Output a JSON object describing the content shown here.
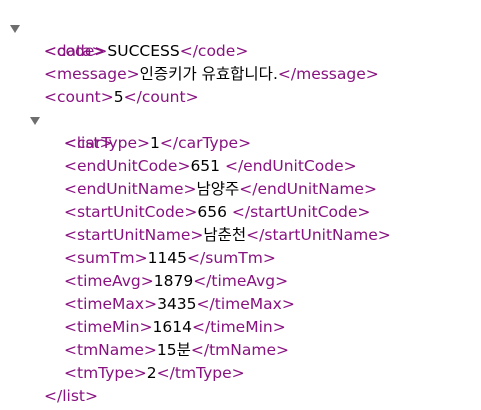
{
  "xml": {
    "root_tag": "data",
    "code": {
      "tag": "code",
      "value": "SUCCESS"
    },
    "message": {
      "tag": "message",
      "value": "인증키가 유효합니다."
    },
    "count": {
      "tag": "count",
      "value": "5"
    },
    "list": {
      "tag": "list",
      "items": [
        {
          "tag": "carType",
          "value": "1"
        },
        {
          "tag": "endUnitCode",
          "value": "651 "
        },
        {
          "tag": "endUnitName",
          "value": "남양주"
        },
        {
          "tag": "startUnitCode",
          "value": "656 "
        },
        {
          "tag": "startUnitName",
          "value": "남춘천"
        },
        {
          "tag": "sumTm",
          "value": "1145"
        },
        {
          "tag": "timeAvg",
          "value": "1879"
        },
        {
          "tag": "timeMax",
          "value": "3435"
        },
        {
          "tag": "timeMin",
          "value": "1614"
        },
        {
          "tag": "tmName",
          "value": "15분"
        },
        {
          "tag": "tmType",
          "value": "2"
        }
      ]
    }
  },
  "colors": {
    "tag": "#881280",
    "text": "#000000",
    "toggle": "#6e6e6e"
  }
}
